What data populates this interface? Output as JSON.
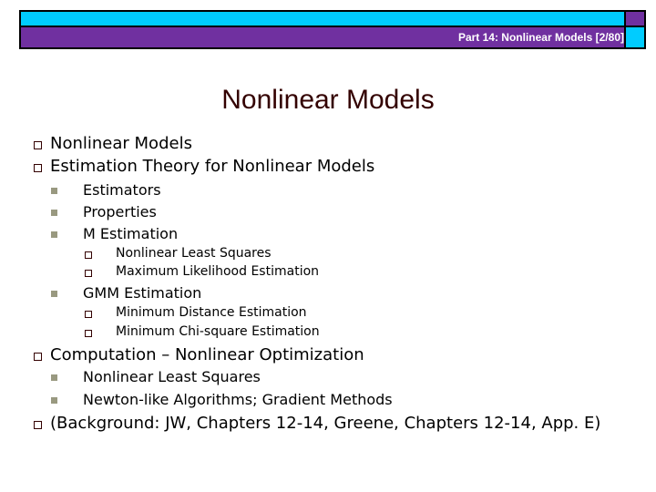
{
  "header": {
    "text": "Part 14: Nonlinear Models [2/80]",
    "colors": {
      "cyan": "#00ccff",
      "purple": "#7030a0"
    }
  },
  "slide": {
    "title": "Nonlinear Models",
    "title_color": "#330000",
    "bullets": [
      {
        "level": 1,
        "icon": "hollow-square-bullet-icon",
        "text": "Nonlinear Models"
      },
      {
        "level": 1,
        "icon": "hollow-square-bullet-icon",
        "text": "Estimation Theory for Nonlinear Models"
      },
      {
        "level": 2,
        "icon": "filled-square-bullet-icon",
        "text": "Estimators"
      },
      {
        "level": 2,
        "icon": "filled-square-bullet-icon",
        "text": "Properties"
      },
      {
        "level": 2,
        "icon": "filled-square-bullet-icon",
        "text": "M Estimation"
      },
      {
        "level": 3,
        "icon": "hollow-square-bullet-icon",
        "text": "Nonlinear Least Squares"
      },
      {
        "level": 3,
        "icon": "hollow-square-bullet-icon",
        "text": "Maximum Likelihood Estimation"
      },
      {
        "level": 2,
        "icon": "filled-square-bullet-icon",
        "text": "GMM Estimation"
      },
      {
        "level": 3,
        "icon": "hollow-square-bullet-icon",
        "text": "Minimum Distance Estimation"
      },
      {
        "level": 3,
        "icon": "hollow-square-bullet-icon",
        "text": "Minimum Chi-square Estimation"
      },
      {
        "level": 1,
        "icon": "hollow-square-bullet-icon",
        "text": "Computation – Nonlinear Optimization"
      },
      {
        "level": 2,
        "icon": "filled-square-bullet-icon",
        "text": "Nonlinear Least Squares"
      },
      {
        "level": 2,
        "icon": "filled-square-bullet-icon",
        "text": "Newton-like Algorithms; Gradient Methods"
      },
      {
        "level": 1,
        "icon": "hollow-square-bullet-icon",
        "text": "(Background: JW, Chapters 12-14, Greene, Chapters 12-14, App. E)"
      }
    ]
  }
}
